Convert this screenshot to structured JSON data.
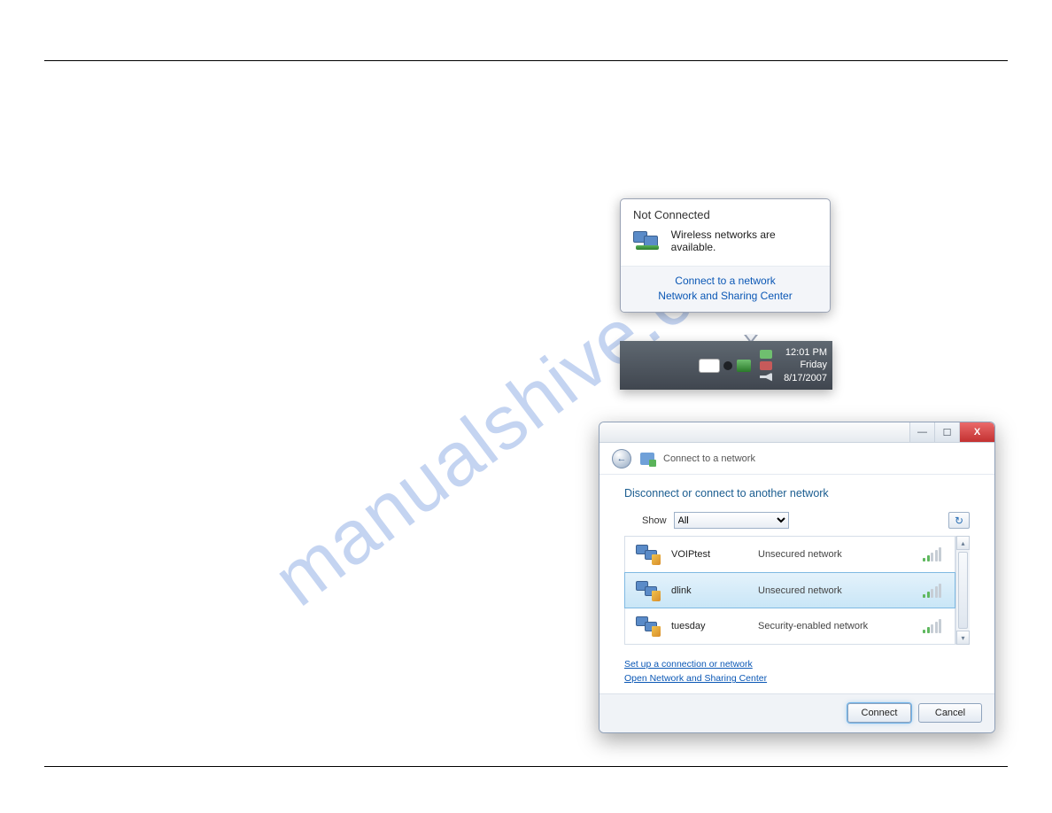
{
  "watermark": "manualshive.com",
  "balloon": {
    "title": "Not Connected",
    "message": "Wireless networks are available.",
    "link1": "Connect to a network",
    "link2": "Network and Sharing Center"
  },
  "taskbar": {
    "time": "12:01 PM",
    "day": "Friday",
    "date": "8/17/2007"
  },
  "dialog": {
    "breadcrumb": "Connect to a network",
    "subtitle": "Disconnect or connect to another network",
    "show_label": "Show",
    "show_value": "All",
    "networks": [
      {
        "name": "VOIPtest",
        "security": "Unsecured network",
        "bars": 2
      },
      {
        "name": "dlink",
        "security": "Unsecured network",
        "bars": 2,
        "selected": true
      },
      {
        "name": "tuesday",
        "security": "Security-enabled network",
        "bars": 2
      }
    ],
    "link1": "Set up a connection or network",
    "link2": "Open Network and Sharing Center",
    "connect": "Connect",
    "cancel": "Cancel",
    "close_glyph": "X",
    "min_glyph": "—",
    "max_glyph": "☐",
    "back_glyph": "←",
    "refresh_glyph": "↻",
    "up_glyph": "▴",
    "down_glyph": "▾"
  }
}
